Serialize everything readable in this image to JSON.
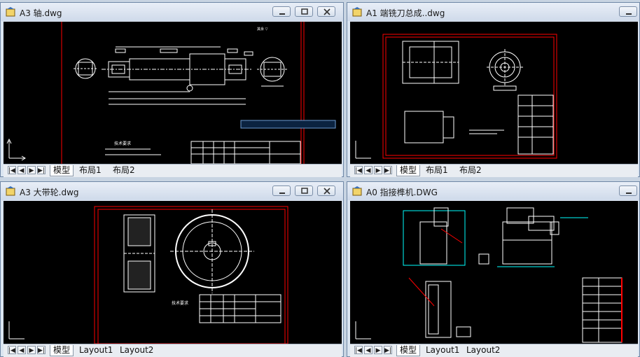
{
  "windows": [
    {
      "title": "A3 轴.dwg",
      "tabs": [
        "模型",
        "布局1",
        "布局2"
      ]
    },
    {
      "title": "A1 端铣刀总成..dwg",
      "tabs": [
        "模型",
        "布局1",
        "布局2"
      ]
    },
    {
      "title": "A3 大带轮.dwg",
      "tabs": [
        "模型",
        "Layout1",
        "Layout2"
      ]
    },
    {
      "title": "A0 指接榫机.DWG",
      "tabs": [
        "模型",
        "Layout1",
        "Layout2"
      ]
    }
  ],
  "drawings": {
    "shaft_tech_title": "技术要求",
    "pulley_tech_title": "技术要求"
  },
  "colors": {
    "canvas": "#000000",
    "border": "#ff0000",
    "geometry": "#ffffff",
    "dimension": "#00ffff"
  }
}
